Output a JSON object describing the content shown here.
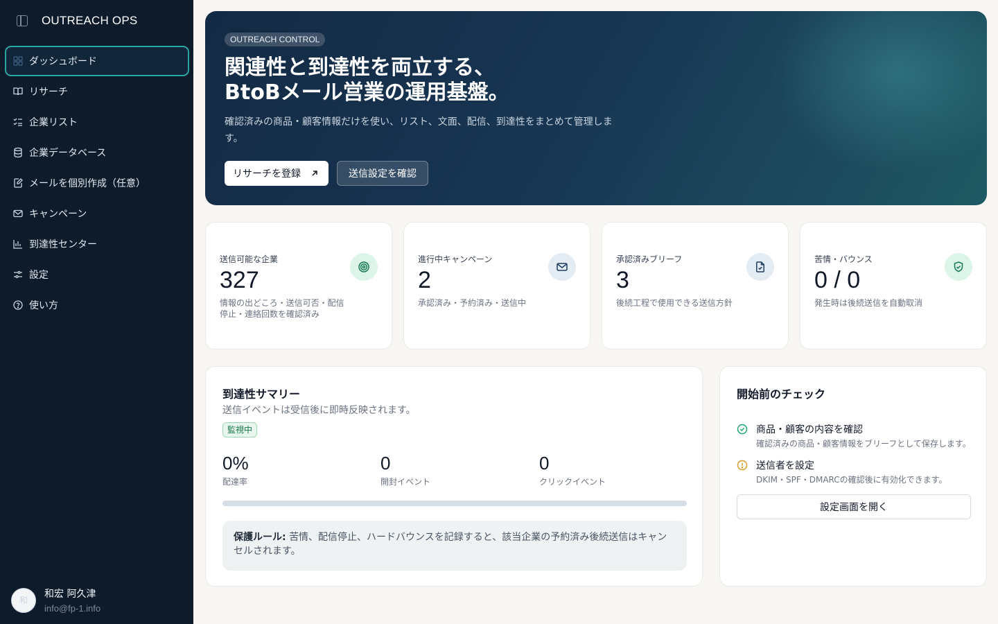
{
  "app": {
    "title": "OUTREACH OPS"
  },
  "sidebar": {
    "items": [
      {
        "label": "ダッシュボード",
        "icon": "layout-grid-icon",
        "active": true
      },
      {
        "label": "リサーチ",
        "icon": "book-open-icon"
      },
      {
        "label": "企業リスト",
        "icon": "list-checks-icon"
      },
      {
        "label": "企業データベース",
        "icon": "database-icon"
      },
      {
        "label": "メールを個別作成（任意）",
        "icon": "file-edit-icon"
      },
      {
        "label": "キャンペーン",
        "icon": "mail-icon"
      },
      {
        "label": "到達性センター",
        "icon": "bar-chart-icon"
      },
      {
        "label": "設定",
        "icon": "sliders-icon"
      },
      {
        "label": "使い方",
        "icon": "help-circle-icon"
      }
    ]
  },
  "user": {
    "name": "和宏 阿久津",
    "email": "info@fp-1.info",
    "avatar_initial": "和"
  },
  "hero": {
    "badge": "OUTREACH CONTROL",
    "title_line1": "関連性と到達性を両立する、",
    "title_line2": "BtoBメール営業の運用基盤。",
    "description": "確認済みの商品・顧客情報だけを使い、リスト、文面、配信、到達性をまとめて管理します。",
    "primary_button": "リサーチを登録",
    "secondary_button": "送信設定を確認"
  },
  "stats": [
    {
      "label": "送信可能な企業",
      "value": "327",
      "desc": "情報の出どころ・送信可否・配信停止・連絡回数を確認済み",
      "icon": "target-icon",
      "icon_bg": "#dcf5e8",
      "icon_color": "#137a52"
    },
    {
      "label": "進行中キャンペーン",
      "value": "2",
      "desc": "承認済み・予約済み・送信中",
      "icon": "mail-icon",
      "icon_bg": "#e3ebf3",
      "icon_color": "#1e3a5f"
    },
    {
      "label": "承認済みブリーフ",
      "value": "3",
      "desc": "後続工程で使用できる送信方針",
      "icon": "file-check-icon",
      "icon_bg": "#e3ebf3",
      "icon_color": "#1e3a5f"
    },
    {
      "label": "苦情・バウンス",
      "value": "0 / 0",
      "desc": "発生時は後続送信を自動取消",
      "icon": "shield-check-icon",
      "icon_bg": "#dcf5e8",
      "icon_color": "#137a52"
    }
  ],
  "summary": {
    "title": "到達性サマリー",
    "subtitle": "送信イベントは受信後に即時反映されます。",
    "status": "監視中",
    "metrics": [
      {
        "value": "0%",
        "label": "配達率"
      },
      {
        "value": "0",
        "label": "開封イベント"
      },
      {
        "value": "0",
        "label": "クリックイベント"
      }
    ],
    "delivery_progress": 0,
    "rule_label": "保護ルール:",
    "rule_text": "苦情、配信停止、ハードバウンスを記録すると、該当企業の予約済み後続送信はキャンセルされます。"
  },
  "checklist": {
    "title": "開始前のチェック",
    "items": [
      {
        "title": "商品・顧客の内容を確認",
        "desc": "確認済みの商品・顧客情報をブリーフとして保存します。",
        "icon": "check-circle-icon",
        "color": "#16a36a"
      },
      {
        "title": "送信者を設定",
        "desc": "DKIM・SPF・DMARCの確認後に有効化できます。",
        "icon": "alert-circle-icon",
        "color": "#d99a1b"
      }
    ],
    "button": "設定画面を開く"
  }
}
